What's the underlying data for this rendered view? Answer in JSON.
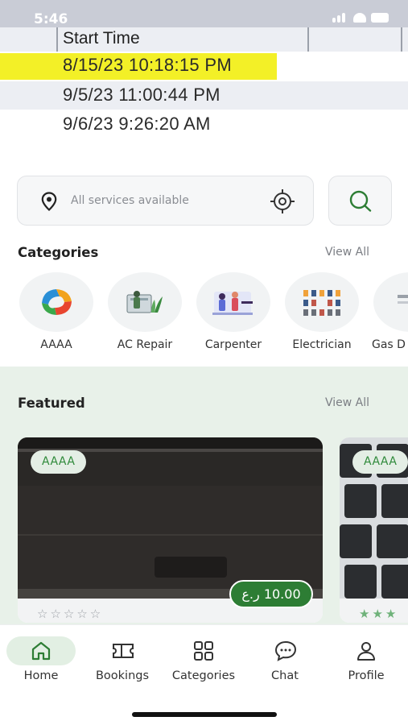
{
  "status_bar": {
    "time": "5:46"
  },
  "banner": {
    "column_header": "Start Time",
    "rows": [
      "8/15/23 10:18:15 PM",
      "9/5/23 11:00:44 PM",
      "9/6/23 9:26:20 AM"
    ]
  },
  "search": {
    "placeholder": "All services available"
  },
  "categories": {
    "title": "Categories",
    "view_all": "View All",
    "items": [
      {
        "label": "AAAA",
        "icon": "logo-icon"
      },
      {
        "label": "AC Repair",
        "icon": "ac-repair-icon"
      },
      {
        "label": "Carpenter",
        "icon": "carpenter-icon"
      },
      {
        "label": "Electrician",
        "icon": "electrician-icon"
      },
      {
        "label": "Gas D",
        "icon": "gas-icon"
      }
    ]
  },
  "featured": {
    "title": "Featured",
    "view_all": "View All",
    "cards": [
      {
        "chip": "AAAA",
        "price": "10.00 ر.ع",
        "rating": 0
      },
      {
        "chip": "AAAA",
        "rating": 3
      }
    ]
  },
  "bottom_nav": [
    {
      "label": "Home",
      "icon": "home-icon",
      "active": true
    },
    {
      "label": "Bookings",
      "icon": "ticket-icon",
      "active": false
    },
    {
      "label": "Categories",
      "icon": "grid-icon",
      "active": false
    },
    {
      "label": "Chat",
      "icon": "chat-icon",
      "active": false
    },
    {
      "label": "Profile",
      "icon": "profile-icon",
      "active": false
    }
  ],
  "colors": {
    "accent": "#2d7d34",
    "chip_bg": "#e4eee5",
    "featured_bg": "#e8f1e9",
    "highlight": "#f3f027"
  }
}
